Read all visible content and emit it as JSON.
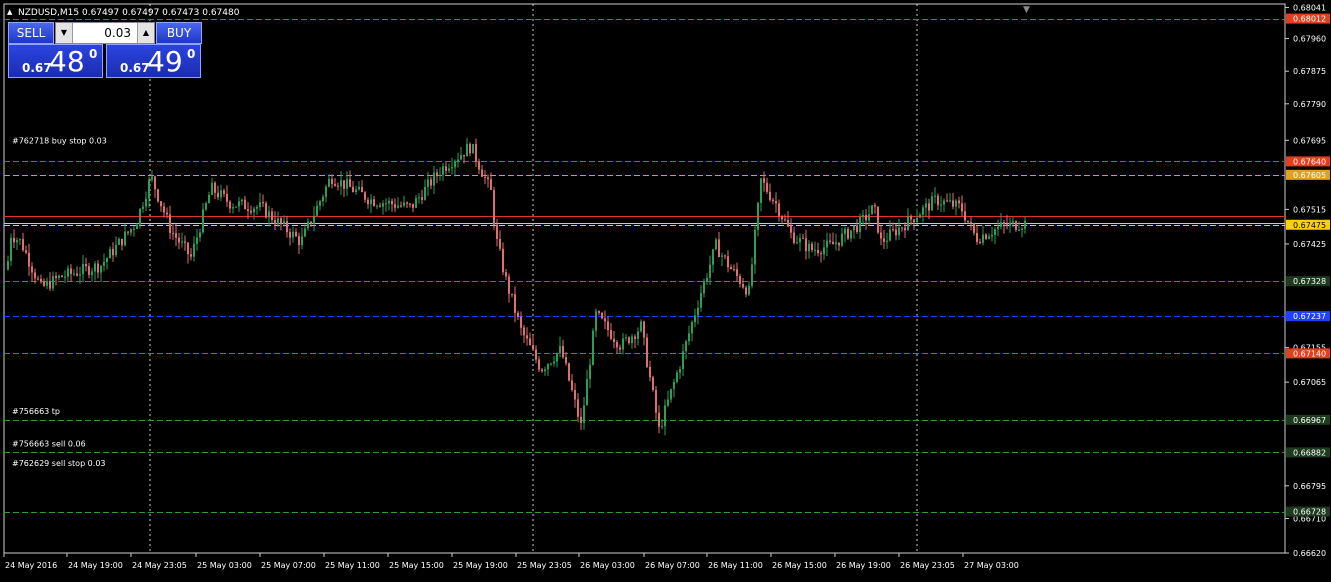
{
  "header": {
    "symbol_info": "NZDUSD,M15  0.67497 0.67497 0.67473 0.67480"
  },
  "trade_panel": {
    "sell_label": "SELL",
    "buy_label": "BUY",
    "lot_value": "0.03",
    "bid": {
      "prefix": "0.67",
      "big": "48",
      "sup": "0"
    },
    "ask": {
      "prefix": "0.67",
      "big": "49",
      "sup": "0"
    }
  },
  "chart": {
    "price_min": 0.6662,
    "price_max": 0.6805,
    "price_ticks": [
      "0.68041",
      "0.67960",
      "0.67875",
      "0.67790",
      "0.67695",
      "0.67515",
      "0.67425",
      "0.67155",
      "0.67065",
      "0.66795",
      "0.66710",
      "0.66620"
    ],
    "time_labels": [
      "24 May 2016",
      "24 May 19:00",
      "24 May 23:05",
      "25 May 03:00",
      "25 May 07:00",
      "25 May 11:00",
      "25 May 15:00",
      "25 May 19:00",
      "25 May 23:05",
      "26 May 03:00",
      "26 May 07:00",
      "26 May 11:00",
      "26 May 15:00",
      "26 May 19:00",
      "26 May 23:05",
      "27 May 03:00"
    ],
    "level_lines": [
      {
        "price": 0.68012,
        "label": "0.68012",
        "color": "#e04020",
        "bg": "#e04020"
      },
      {
        "price": 0.6764,
        "label": "0.67640",
        "color": "#e04020",
        "bg": "#e04020"
      },
      {
        "price": 0.67605,
        "label": "0.67605",
        "color": "#e0a020",
        "bg": "#e0a020"
      },
      {
        "price": 0.67475,
        "label": "0.67475",
        "color": "#ffd000",
        "bg": "#ffd000"
      },
      {
        "price": 0.67328,
        "label": "0.67328",
        "color": "#2a9a2a",
        "bg": "#1e3a1e"
      },
      {
        "price": 0.67237,
        "label": "0.67237",
        "color": "#2040ff",
        "bg": "#2040ff"
      },
      {
        "price": 0.6714,
        "label": "0.67140",
        "color": "#e04020",
        "bg": "#e04020"
      },
      {
        "price": 0.66967,
        "label": "0.66967",
        "color": "#2a9a2a",
        "bg": "#1e3a1e"
      },
      {
        "price": 0.66882,
        "label": "0.66882",
        "color": "#2a9a2a",
        "bg": "#1e3a1e"
      },
      {
        "price": 0.66728,
        "label": "0.66728",
        "color": "#2a9a2a",
        "bg": "#1e3a1e"
      }
    ],
    "orders": [
      {
        "text": "#762718 buy stop 0.03"
      },
      {
        "text": "#756663 tp"
      },
      {
        "text": "#756663 sell 0.06"
      },
      {
        "text": "#762629 sell stop 0.03"
      }
    ],
    "colors": {
      "bull": "#2e9e55",
      "bear": "#e07070",
      "grid": "#ffffff",
      "axis": "#ffffff"
    }
  }
}
